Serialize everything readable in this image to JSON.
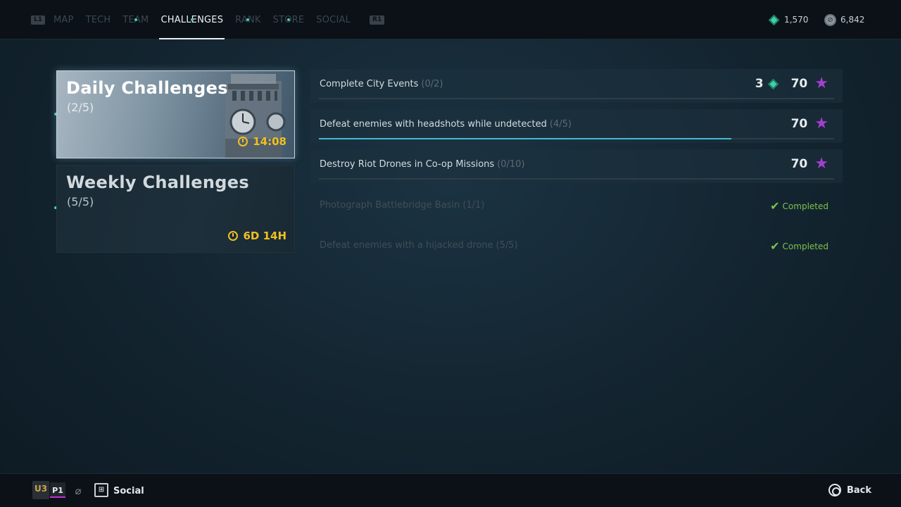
{
  "nav": {
    "left_hint": "L1",
    "right_hint": "R1",
    "tabs": [
      {
        "label": "MAP",
        "dot": false,
        "active": false
      },
      {
        "label": "TECH",
        "dot": false,
        "active": false
      },
      {
        "label": "TEAM",
        "dot": true,
        "active": false
      },
      {
        "label": "CHALLENGES",
        "dot": true,
        "active": true
      },
      {
        "label": "RANK",
        "dot": true,
        "active": false
      },
      {
        "label": "STORE",
        "dot": true,
        "active": false
      },
      {
        "label": "SOCIAL",
        "dot": false,
        "active": false
      }
    ]
  },
  "currency": {
    "gems": "1,570",
    "coins": "6,842"
  },
  "categories": {
    "daily": {
      "title": "Daily Challenges",
      "count": "(2/5)",
      "timer": "14:08"
    },
    "weekly": {
      "title": "Weekly Challenges",
      "count": "(5/5)",
      "timer": "6D 14H"
    }
  },
  "challenges": [
    {
      "label": "Complete City Events",
      "progress": "(0/2)",
      "gem_reward": "3",
      "star_reward": "70",
      "fill_fraction": 0
    },
    {
      "label": "Defeat enemies with headshots while undetected",
      "progress": "(4/5)",
      "star_reward": "70",
      "fill_fraction": 0.8
    },
    {
      "label": "Destroy Riot Drones in Co-op Missions",
      "progress": "(0/10)",
      "star_reward": "70",
      "fill_fraction": 0
    },
    {
      "label": "Photograph Battlebridge Basin",
      "progress": "(1/1)",
      "status": "Completed"
    },
    {
      "label": "Defeat enemies with a hijacked drone",
      "progress": "(5/5)",
      "status": "Completed"
    }
  ],
  "bottom": {
    "badge": "U3",
    "player": "P1",
    "social_label": "Social",
    "back_label": "Back"
  },
  "colors": {
    "accent_gem": "#3fd1a8",
    "star": "#a23fd0",
    "timer": "#f0c020",
    "completed": "#7cc34a",
    "progress_fill": "#46b9d6"
  }
}
